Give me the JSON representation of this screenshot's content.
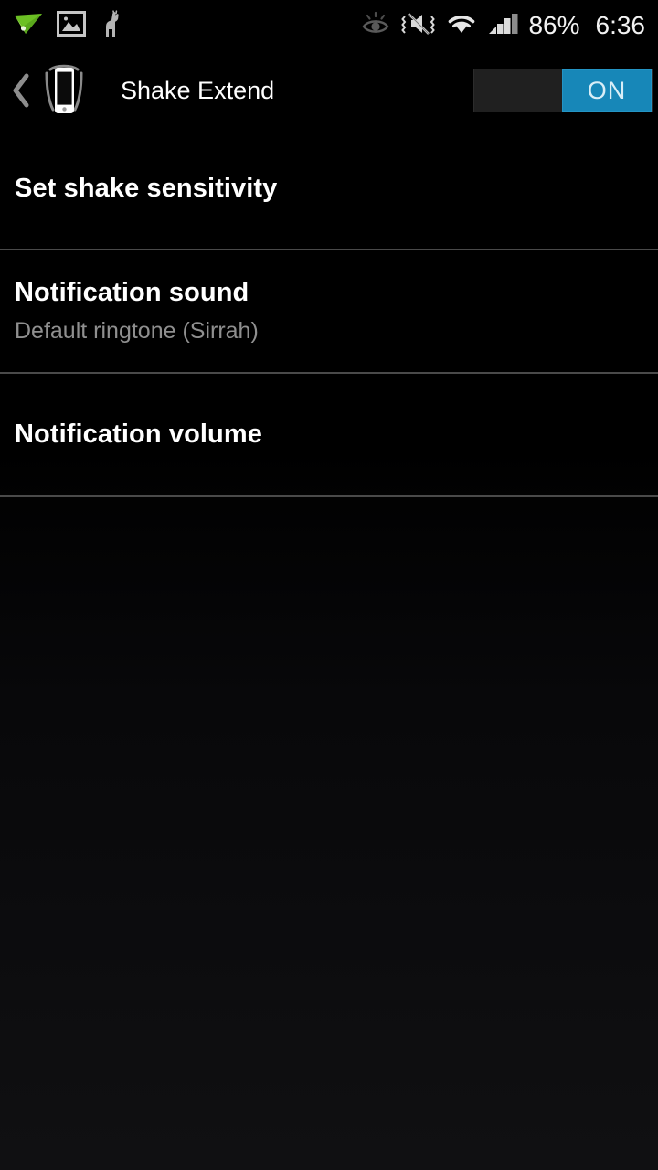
{
  "status_bar": {
    "left_icons": [
      {
        "name": "paper-plane-icon",
        "label": "airdroid-notification"
      },
      {
        "name": "gallery-image-icon",
        "label": "screenshot-captured"
      },
      {
        "name": "llama-icon",
        "label": "llama-app-notification"
      }
    ],
    "right_icons": [
      {
        "name": "smart-stay-eye-icon",
        "label": "smart-stay"
      },
      {
        "name": "mute-vibrate-icon",
        "label": "sound-off-vibrate"
      },
      {
        "name": "wifi-icon",
        "label": "wifi-connected"
      },
      {
        "name": "signal-bars-icon",
        "label": "cellular-signal"
      }
    ],
    "battery_percent": "86%",
    "clock": "6:36"
  },
  "action_bar": {
    "back_label": "‹",
    "app_icon_name": "shaking-phone-icon",
    "title": "Shake Extend",
    "toggle": {
      "state_label": "ON",
      "is_on": true,
      "track_color": "#202020",
      "thumb_color": "#1787b8",
      "label_color": "#d9eef7"
    }
  },
  "settings_list": [
    {
      "title": "Set shake sensitivity",
      "subtitle": ""
    },
    {
      "title": "Notification sound",
      "subtitle": "Default ringtone (Sirrah)"
    },
    {
      "title": "Notification volume",
      "subtitle": ""
    }
  ],
  "colors": {
    "background": "#000000",
    "title_text": "#ffffff",
    "subtitle_text": "#8f8f8f",
    "divider": "#4a4a4a",
    "accent": "#1787b8"
  }
}
